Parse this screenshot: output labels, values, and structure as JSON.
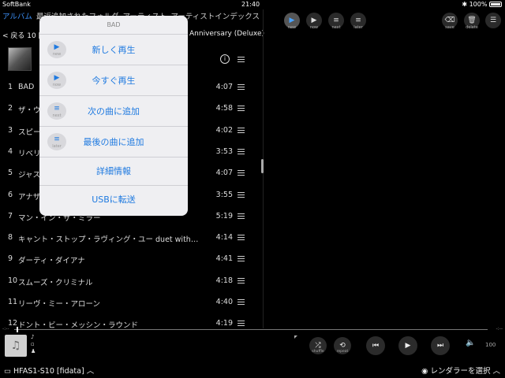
{
  "status_bar": {
    "carrier": "SoftBank",
    "time": "21:40",
    "battery": "100%"
  },
  "tabs": {
    "album": "アルバム",
    "recent_folder": "最近追加されたフォルダ",
    "artist": "アーティスト",
    "artist_index": "アーティストインデックス"
  },
  "album_header": {
    "back": "< 戻る",
    "title_prefix": "10 [B",
    "title_suffix": "Anniversary (Deluxe)"
  },
  "tracks": [
    {
      "num": "1",
      "title": "BAD",
      "dur": "4:07"
    },
    {
      "num": "2",
      "title": "ザ・ウ",
      "dur": "4:58"
    },
    {
      "num": "3",
      "title": "スピー",
      "dur": "4:02"
    },
    {
      "num": "4",
      "title": "リベリ",
      "dur": "3:53"
    },
    {
      "num": "5",
      "title": "ジャス                                      ヴ…",
      "dur": "4:07"
    },
    {
      "num": "6",
      "title": "アナザ",
      "dur": "3:55"
    },
    {
      "num": "7",
      "title": "マン・イン・ザ・ミラー",
      "dur": "5:19"
    },
    {
      "num": "8",
      "title": "キャント・ストップ・ラヴィング・ユー duet with…",
      "dur": "4:14"
    },
    {
      "num": "9",
      "title": "ダーティ・ダイアナ",
      "dur": "4:41"
    },
    {
      "num": "10",
      "title": "スムーズ・クリミナル",
      "dur": "4:18"
    },
    {
      "num": "11",
      "title": "リーヴ・ミー・アローン",
      "dur": "4:40"
    },
    {
      "num": "12",
      "title": "ドント・ビー・メッシン・ラウンド",
      "dur": "4:19"
    }
  ],
  "popup": {
    "title": "BAD",
    "items": [
      {
        "label": "新しく再生",
        "icon_caption": "new",
        "icon": "play-new-icon"
      },
      {
        "label": "今すぐ再生",
        "icon_caption": "now",
        "icon": "play-now-icon"
      },
      {
        "label": "次の曲に追加",
        "icon_caption": "next",
        "icon": "queue-next-icon"
      },
      {
        "label": "最後の曲に追加",
        "icon_caption": "later",
        "icon": "queue-later-icon"
      },
      {
        "label": "詳細情報"
      },
      {
        "label": "USBに転送"
      }
    ]
  },
  "toolbar": {
    "new": "new",
    "now": "now",
    "next": "next",
    "later": "later",
    "save": "save",
    "delete": "delete"
  },
  "progress": {
    "elapsed": "-:--",
    "remaining": "-:--"
  },
  "controls": {
    "shuffle": "shuffle",
    "repeat": "repeat",
    "volume": "100"
  },
  "footer": {
    "device": "HFAS1-S10 [fidata]",
    "renderer": "レンダラーを選択"
  },
  "colors": {
    "accent": "#1f7ae0",
    "popup_bg": "#efeff2",
    "background": "#000000"
  }
}
